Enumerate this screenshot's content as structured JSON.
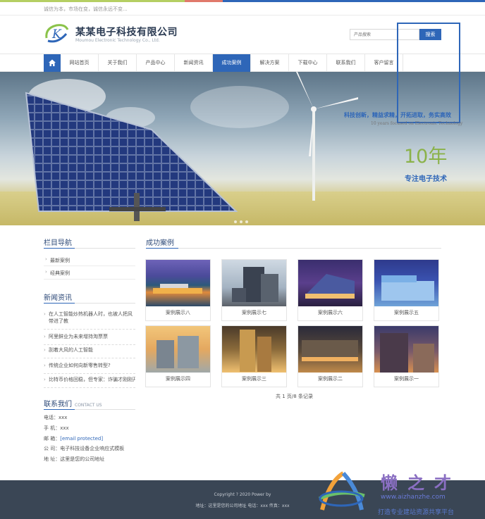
{
  "topbar": {
    "slogan": "诚信为本，市场在变，诚信永远不变..."
  },
  "brand": {
    "name": "某某电子科技有限公司",
    "name_en": "Moumou Electronic Technology Co., Ltd.",
    "logo_letter": "K"
  },
  "search": {
    "placeholder": "产品搜索",
    "button": "搜索"
  },
  "nav": {
    "home_icon": "home-icon",
    "items": [
      "网站首页",
      "关于我们",
      "产品中心",
      "新闻资讯",
      "成功案例",
      "解决方案",
      "下载中心",
      "联系我们",
      "客户留言"
    ],
    "active": "成功案例"
  },
  "banner": {
    "tagline": "科技创新，精益求精，开拓进取，务实高效",
    "tagline_en": "10 years focused on Electronic Technology",
    "big": "10年",
    "sub": "专注电子技术"
  },
  "sidebar": {
    "category_title": "栏目导航",
    "categories": [
      "最新案例",
      "经典案例"
    ],
    "news_title": "新闻资讯",
    "news": [
      "在人工智能炒热机器人时，也被人把风带进了教",
      "阿里鲜业为未来增持淘票票",
      "刮着大风的人工智能",
      "传统企业如何向新零售转型?",
      "比特币价格回稳，但专家：诈骗才刚刚开始"
    ],
    "contact_title": "联系我们",
    "contact_title_en": "CONTACT US",
    "contact": {
      "phone": "电话：xxx",
      "mobile": "手 机：xxx",
      "email_label": "邮 箱：",
      "email_value": "[email protected]",
      "company": "公 司：电子科技设备企业响应式模板",
      "address": "地 址：这里是您的公司地址"
    }
  },
  "main": {
    "title": "成功案例",
    "cases": [
      "案例展示八",
      "案例展示七",
      "案例展示六",
      "案例展示五",
      "案例展示四",
      "案例展示三",
      "案例展示二",
      "案例展示一"
    ],
    "pager": "共 1 页/8 条记录"
  },
  "footer": {
    "copyright": "Copyright ? 2020 Power by",
    "address_line": "地址：这里是您的公司地址  电话：xxx  传真：xxx"
  },
  "watermark": {
    "title": "懒之才",
    "url": "www.aizhanzhe.com",
    "slogan": "打造专业建站资源共享平台"
  },
  "colors": {
    "accent": "#2e66b8",
    "footer": "#3a4655",
    "title": "#2e4a78",
    "banner_green": "#8bb24a"
  }
}
